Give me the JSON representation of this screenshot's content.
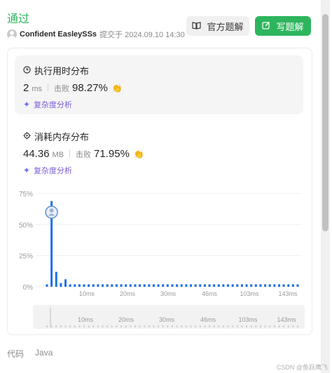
{
  "header": {
    "status": "通过",
    "username": "Confident EasleySSs",
    "submitted_at": "提交于 2024.09.10 14:30",
    "solution_button": "官方题解",
    "write_button": "写题解"
  },
  "runtime": {
    "title": "执行用时分布",
    "value": "2",
    "unit": "ms",
    "beat_label": "击败",
    "beat_pct": "98.27%",
    "complexity_link": "复杂度分析"
  },
  "memory": {
    "title": "消耗内存分布",
    "value": "44.36",
    "unit": "MB",
    "beat_label": "击败",
    "beat_pct": "71.95%",
    "complexity_link": "复杂度分析"
  },
  "chart_data": {
    "type": "bar",
    "y_ticks": [
      "75%",
      "50%",
      "25%",
      "0%"
    ],
    "ylim": [
      0,
      75
    ],
    "x_ticks": [
      "10ms",
      "20ms",
      "30ms",
      "46ms",
      "103ms",
      "143ms"
    ],
    "values": [
      2,
      69,
      12,
      3,
      6,
      2,
      2,
      2,
      2,
      2,
      2,
      2,
      2,
      2,
      2,
      2,
      2,
      2,
      2,
      2,
      2,
      2,
      2,
      2,
      2,
      2,
      2,
      2,
      2,
      2,
      2,
      2,
      2,
      2,
      2,
      2,
      2,
      2,
      2,
      2,
      2,
      2,
      2,
      2,
      2,
      2,
      2,
      2,
      2,
      2,
      2,
      2,
      2,
      2,
      2
    ],
    "highlight_index": 1,
    "bar_color": "#1d6fe8",
    "grid": true
  },
  "footer": {
    "code_label": "代码",
    "language": "Java"
  },
  "watermark": "CSDN @鱼跃鹰飞"
}
